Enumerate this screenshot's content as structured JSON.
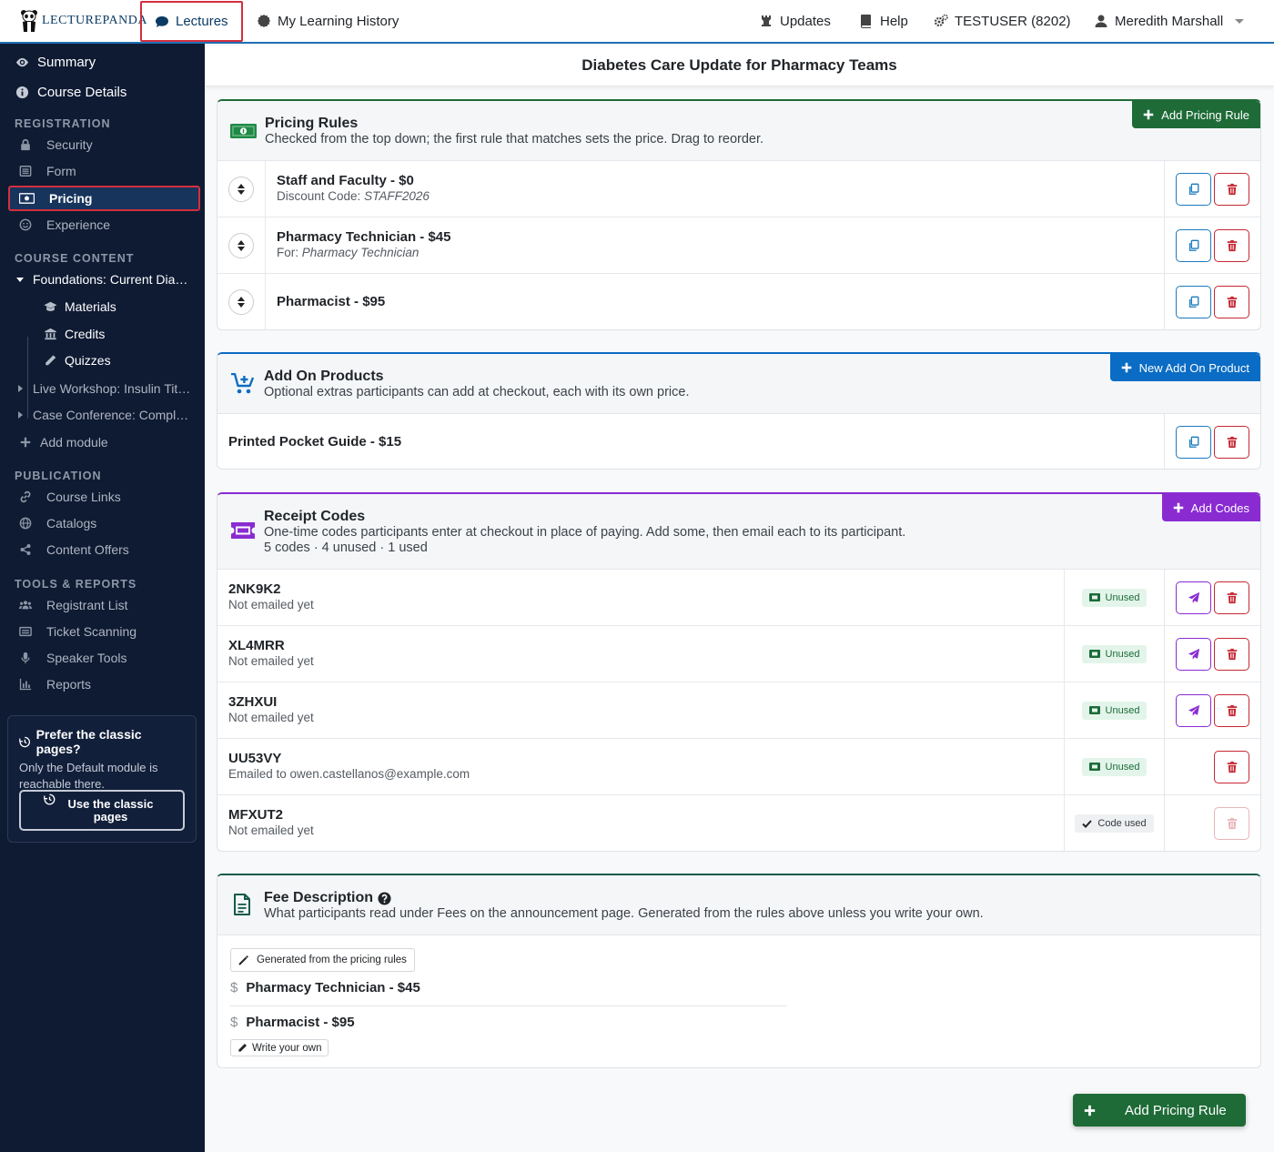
{
  "app": {
    "logo_text": "LECTUREPANDA"
  },
  "topnav": {
    "lectures": "Lectures",
    "history": "My Learning History",
    "updates": "Updates",
    "help": "Help",
    "testuser": "TESTUSER (8202)",
    "user": "Meredith Marshall"
  },
  "page_title": "Diabetes Care Update for Pharmacy Teams",
  "sidebar": {
    "summary": "Summary",
    "course_details": "Course Details",
    "registration_head": "REGISTRATION",
    "security": "Security",
    "form": "Form",
    "pricing": "Pricing",
    "experience": "Experience",
    "course_content_head": "COURSE CONTENT",
    "module1": "Foundations: Current Dia…",
    "materials": "Materials",
    "credits": "Credits",
    "quizzes": "Quizzes",
    "module2": "Live Workshop: Insulin Tit…",
    "module3": "Case Conference: Compl…",
    "add_module": "Add module",
    "publication_head": "PUBLICATION",
    "course_links": "Course Links",
    "catalogs": "Catalogs",
    "content_offers": "Content Offers",
    "tools_head": "TOOLS & REPORTS",
    "registrant_list": "Registrant List",
    "ticket_scanning": "Ticket Scanning",
    "speaker_tools": "Speaker Tools",
    "reports": "Reports",
    "classic_title": "Prefer the classic pages?",
    "classic_text": "Only the Default module is reachable there.",
    "classic_button": "Use the classic pages"
  },
  "pricing_rules": {
    "title": "Pricing Rules",
    "subtitle": "Checked from the top down; the first rule that matches sets the price. Drag to reorder.",
    "add_button": "Add Pricing Rule",
    "rules": [
      {
        "title": "Staff and Faculty - $0",
        "sub_label": "Discount Code:",
        "sub_value": "STAFF2026"
      },
      {
        "title": "Pharmacy Technician - $45",
        "sub_label": "For:",
        "sub_value": "Pharmacy Technician"
      },
      {
        "title": "Pharmacist - $95",
        "sub_label": "",
        "sub_value": ""
      }
    ]
  },
  "add_on_products": {
    "title": "Add On Products",
    "subtitle": "Optional extras participants can add at checkout, each with its own price.",
    "add_button": "New Add On Product",
    "items": [
      {
        "title": "Printed Pocket Guide - $15"
      }
    ]
  },
  "receipt_codes": {
    "title": "Receipt Codes",
    "subtitle": "One-time codes participants enter at checkout in place of paying. Add some, then email each to its participant.",
    "summary": "5 codes · 4 unused · 1 used",
    "add_button": "Add Codes",
    "codes": [
      {
        "code": "2NK9K2",
        "status_text": "Not emailed yet",
        "badge": "Unused"
      },
      {
        "code": "XL4MRR",
        "status_text": "Not emailed yet",
        "badge": "Unused"
      },
      {
        "code": "3ZHXUI",
        "status_text": "Not emailed yet",
        "badge": "Unused"
      },
      {
        "code": "UU53VY",
        "status_text": "Emailed to owen.castellanos@example.com",
        "badge": "Unused"
      },
      {
        "code": "MFXUT2",
        "status_text": "Not emailed yet",
        "badge": "Code used"
      }
    ]
  },
  "fee_description": {
    "title": "Fee Description",
    "subtitle": "What participants read under Fees on the announcement page. Generated from the rules above unless you write your own.",
    "generated_chip": "Generated from the pricing rules",
    "lines": [
      "Pharmacy Technician - $45",
      "Pharmacist - $95"
    ],
    "write_own": "Write your own"
  },
  "floating_button": "Add Pricing Rule",
  "colors": {
    "sidebar_bg": "#0f1b33",
    "pricing_green": "#1e6b37",
    "addon_blue": "#0a6cc4",
    "receipt_purple": "#8a2bd1",
    "fee_teal": "#145a4a",
    "danger": "#c62833"
  }
}
